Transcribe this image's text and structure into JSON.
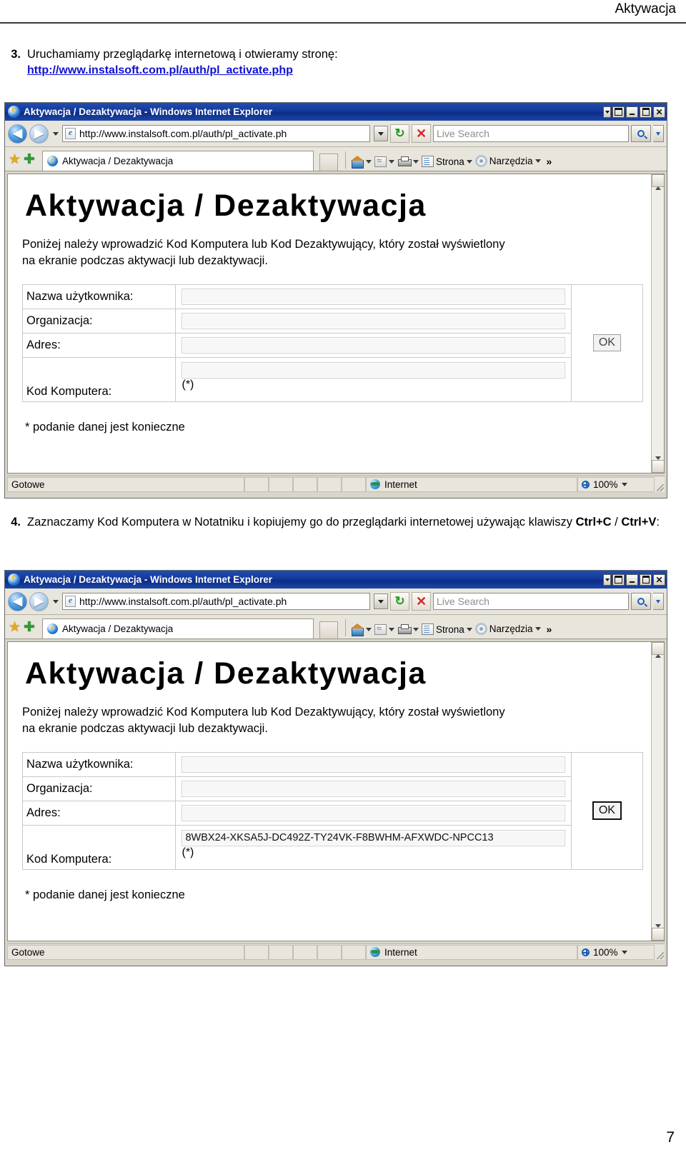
{
  "document": {
    "header_title": "Aktywacja",
    "page_number": "7"
  },
  "steps": [
    {
      "number": "3.",
      "text": "Uruchamiamy przeglądarkę internetową i otwieramy stronę:",
      "link": "http://www.instalsoft.com.pl/auth/pl_activate.php"
    },
    {
      "number": "4.",
      "text_before": "Zaznaczamy Kod Komputera w Notatniku i kopiujemy go do przeglądarki internetowej używając klawiszy ",
      "kbd1": "Ctrl+C",
      "text_between": " / ",
      "kbd2": "Ctrl+V",
      "text_after": ":"
    }
  ],
  "browser": {
    "window_title": "Aktywacja / Dezaktywacja - Windows Internet Explorer",
    "address_value": "http://www.instalsoft.com.pl/auth/pl_activate.ph",
    "search_placeholder": "Live Search",
    "tab_label": "Aktywacja / Dezaktywacja",
    "command_bar": {
      "home_label": "",
      "page_label": "Strona",
      "tools_label": "Narzędzia",
      "overflow_label": "»"
    },
    "status": {
      "ready": "Gotowe",
      "zone": "Internet",
      "zoom": "100%"
    },
    "icons": {
      "back": "◀",
      "forward": "▶",
      "refresh": "↻",
      "stop": "✕",
      "close": "✕"
    }
  },
  "page": {
    "heading": "Aktywacja / Dezaktywacja",
    "description_line1": "Poniżej należy wprowadzić Kod Komputera lub Kod Dezaktywujący, który został wyświetlony",
    "description_line2": "na ekranie podczas aktywacji lub dezaktywacji.",
    "fields": [
      {
        "label": "Nazwa użytkownika:",
        "value_empty": "",
        "value_filled": ""
      },
      {
        "label": "Organizacja:",
        "value_empty": "",
        "value_filled": ""
      },
      {
        "label": "Adres:",
        "value_empty": "",
        "value_filled": ""
      },
      {
        "label": "Kod Komputera:",
        "value_empty": "",
        "value_filled": "8WBX24-XKSA5J-DC492Z-TY24VK-F8BWHM-AFXWDC-NPCC13"
      }
    ],
    "required_marker": "(*)",
    "required_note": "* podanie danej jest konieczne",
    "ok_button": "OK"
  },
  "colors": {
    "link": "#1010d0",
    "titlebar": "#15399b",
    "chrome": "#e8e5dd",
    "page_bg": "#ffffff"
  }
}
